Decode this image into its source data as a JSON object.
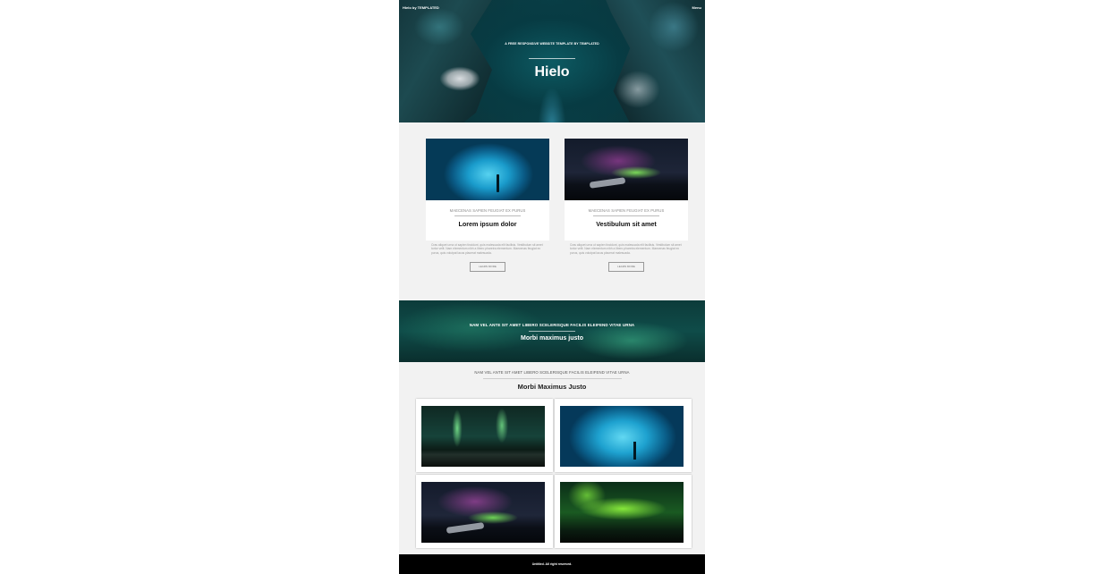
{
  "header": {
    "brand": "Hielo by TEMPLATED",
    "menu_label": "Menu"
  },
  "hero": {
    "subtitle": "A FREE RESPONSIVE WEBSITE TEMPLATE BY TEMPLATED",
    "title": "Hielo"
  },
  "cards": [
    {
      "subtitle": "MAECENAS SAPIEN FEUGIAT EX PURUS",
      "title": "Lorem ipsum dolor",
      "text": "Cras aliquet urna ut sapien tincidunt, quis malesuada elit facilisis. Vestibulum sit amet tortor velit. Nam elementum nibh a libero pharetra elementum. Maecenas feugiat ex purus, quis volutpat lacus placerat malesuada.",
      "button": "LEARN MORE"
    },
    {
      "subtitle": "MAECENAS SAPIEN FEUGIAT EX PURUS",
      "title": "Vestibulum sit amet",
      "text": "Cras aliquet urna ut sapien tincidunt, quis malesuada elit facilisis. Vestibulum sit amet tortor velit. Nam elementum nibh a libero pharetra elementum. Maecenas feugiat ex purus, quis volutpat lacus placerat malesuada.",
      "button": "LEARN MORE"
    }
  ],
  "banner": {
    "subtitle": "NAM VEL ANTE SIT AMET LIBERO SCELERISQUE FACILIS ELEIFEND VITAE URNA",
    "title": "Morbi maximus justo"
  },
  "gallery": {
    "subtitle": "NAM VEL ANTE SIT AMET LIBERO SCELERISQUE FACILIS ELEIFEND VITAE URNA",
    "title": "Morbi Maximus Justo",
    "images": [
      "aurora-green-lake",
      "ice-cave",
      "aurora-plane-wreck",
      "aurora-bright-green"
    ]
  },
  "footer": {
    "text": "Untitled. All right reserved."
  }
}
